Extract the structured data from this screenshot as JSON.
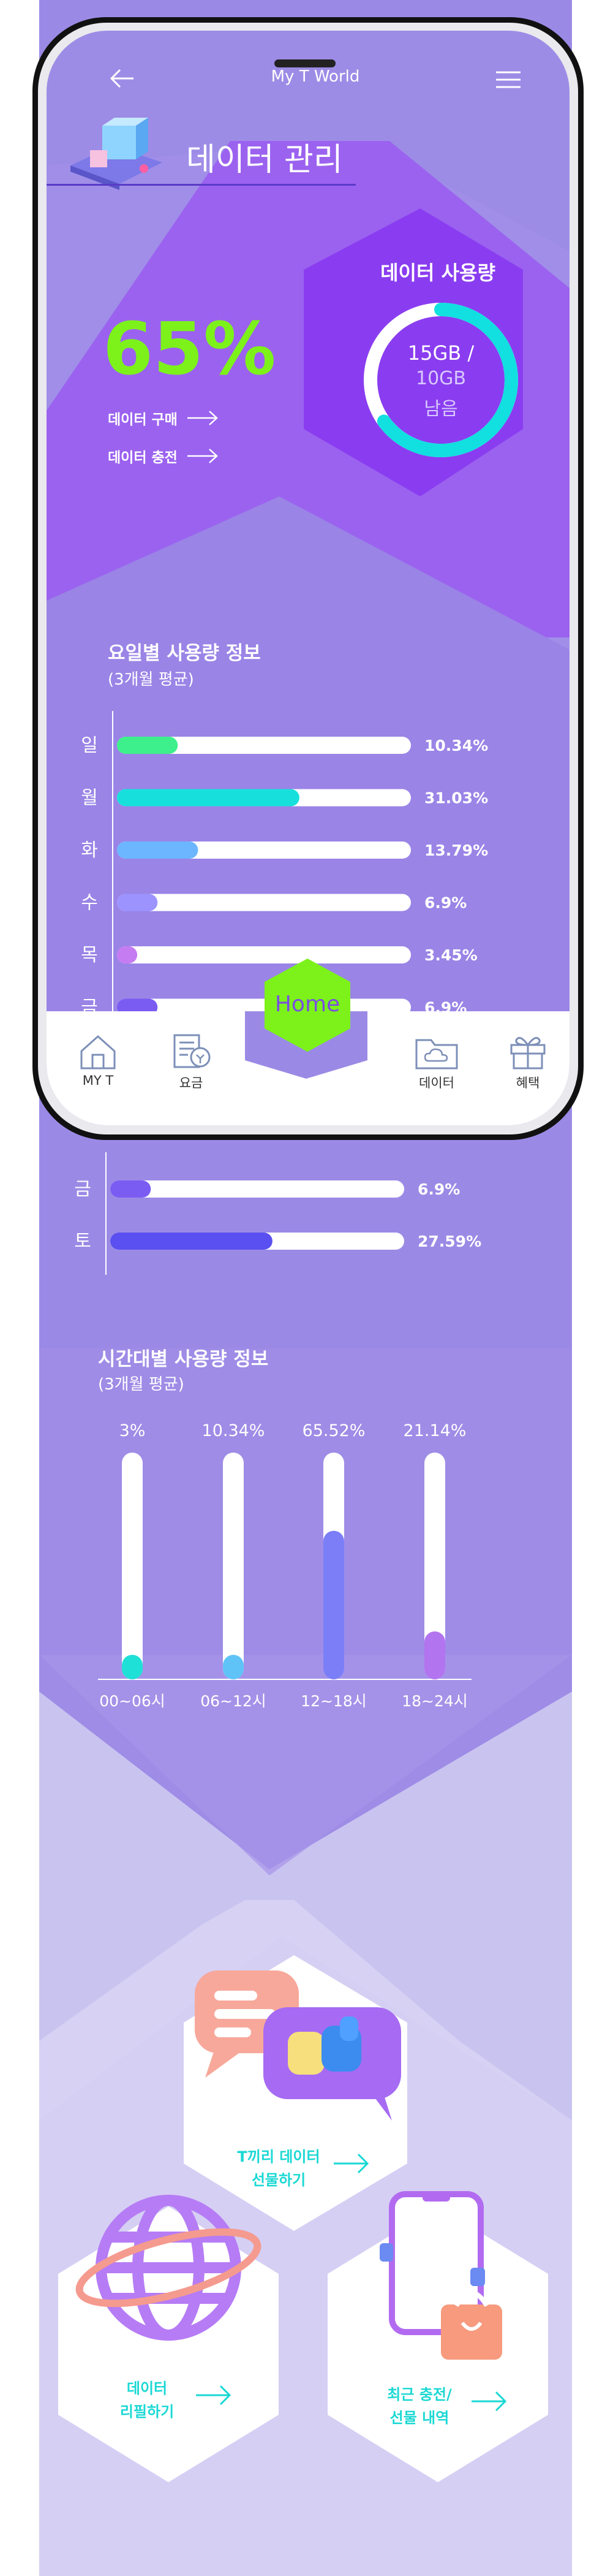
{
  "app": {
    "title": "My T World"
  },
  "header": {
    "title": "데이터 관리"
  },
  "usage": {
    "percent": "65%",
    "percent_value": 65,
    "buy_label": "데이터 구매",
    "charge_label": "데이터 충전",
    "panel_title": "데이터 사용량",
    "used": "15GB /",
    "total": "10GB",
    "remain_label": "남음"
  },
  "daily": {
    "title": "요일별 사용량 정보",
    "subtitle": "(3개월 평균)",
    "items": [
      {
        "day": "일",
        "value": 10.34,
        "label": "10.34%",
        "color": "#3ef08b"
      },
      {
        "day": "월",
        "value": 31.03,
        "label": "31.03%",
        "color": "#17e0dc"
      },
      {
        "day": "화",
        "value": 13.79,
        "label": "13.79%",
        "color": "#6cb6ff"
      },
      {
        "day": "수",
        "value": 6.9,
        "label": "6.9%",
        "color": "#9c93ff"
      },
      {
        "day": "목",
        "value": 3.45,
        "label": "3.45%",
        "color": "#c57cf2"
      },
      {
        "day": "금",
        "value": 6.9,
        "label": "6.9%",
        "color": "#7b5cf2"
      },
      {
        "day": "토",
        "value": 27.59,
        "label": "27.59%",
        "color": "#5a4ff0"
      }
    ]
  },
  "hourly": {
    "title": "시간대별 사용량 정보",
    "subtitle": "(3개월 평균)",
    "items": [
      {
        "range": "00~06시",
        "value": 3,
        "label": "3%",
        "color": "#1fe0d6"
      },
      {
        "range": "06~12시",
        "value": 10.34,
        "label": "10.34%",
        "color": "#5fc3f7"
      },
      {
        "range": "12~18시",
        "value": 65.52,
        "label": "65.52%",
        "color": "#7b7ef7"
      },
      {
        "range": "18~24시",
        "value": 21.14,
        "label": "21.14%",
        "color": "#b274ef"
      }
    ]
  },
  "tabbar": {
    "items": [
      {
        "label": "MY T",
        "icon": "home-icon"
      },
      {
        "label": "요금",
        "icon": "bill-icon"
      },
      {
        "label": "데이터",
        "icon": "cloud-folder-icon"
      },
      {
        "label": "혜택",
        "icon": "gift-icon"
      }
    ],
    "home_label": "Home"
  },
  "actions": {
    "gift": {
      "line1": "T끼리 데이터",
      "line2": "선물하기"
    },
    "roaming": {
      "line1": "데이터",
      "line2": "리필하기"
    },
    "history": {
      "line1": "최근 충전/",
      "line2": "선물 내역"
    }
  },
  "colors": {
    "accent_lime": "#7cf21a",
    "ring_cyan": "#12dfe0",
    "bg_purple": "#9d89e6",
    "panel_purple": "#8a3df0",
    "text_cyan": "#1ad8d4"
  }
}
